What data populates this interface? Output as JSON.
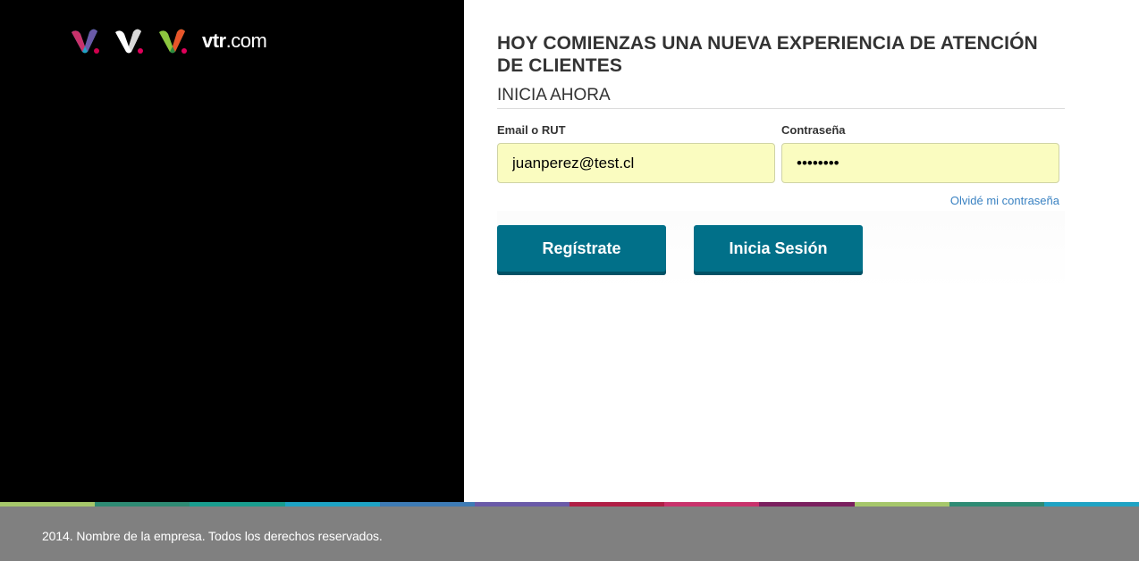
{
  "brand": {
    "logo_icons": [
      "vtr-logo-icon-multicolor",
      "vtr-logo-icon-white",
      "vtr-logo-icon-green"
    ],
    "name_bold": "vtr",
    "name_suffix": ".com"
  },
  "login": {
    "headline": "HOY COMIENZAS UNA NUEVA EXPERIENCIA DE ATENCIÓN DE CLIENTES",
    "subheading": "INICIA AHORA",
    "email_label": "Email o RUT",
    "email_value": "juanperez@test.cl",
    "password_label": "Contraseña",
    "password_value": "12345678",
    "forgot_password": "Olvidé mi contraseña",
    "register_button": "Regístrate",
    "login_button": "Inicia Sesión"
  },
  "footer": {
    "copyright": "2014. Nombre de la empresa. Todos los derechos reservados."
  },
  "colors": {
    "left_panel": "#000000",
    "input_background": "#fafcc0",
    "button": "#017089",
    "link": "#3a82c2",
    "footer": "#808080",
    "strip": [
      "#a6c76b",
      "#2e8b74",
      "#1a9e8f",
      "#1fa3c4",
      "#3e7bb5",
      "#6a5aa8",
      "#b01e45",
      "#c8326b",
      "#7a1f5e",
      "#a6c76b",
      "#2e8b74",
      "#1fa3c4"
    ]
  }
}
